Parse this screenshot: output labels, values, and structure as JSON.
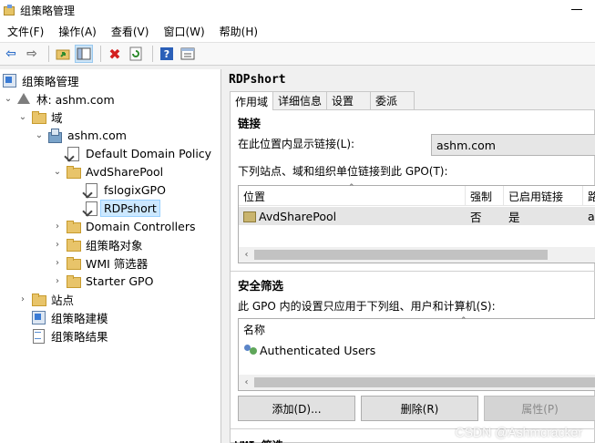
{
  "window": {
    "title": "组策略管理"
  },
  "menu": [
    "文件(F)",
    "操作(A)",
    "查看(V)",
    "窗口(W)",
    "帮助(H)"
  ],
  "toolbar": [
    "back-icon",
    "forward-icon",
    "up-folder-icon",
    "show-tree-icon",
    "delete-icon",
    "refresh-icon",
    "help-icon",
    "console-icon"
  ],
  "tree": {
    "root": "组策略管理",
    "forest": "林: ashm.com",
    "domains": "域",
    "domain": "ashm.com",
    "default_policy": "Default Domain Policy",
    "ou": "AvdSharePool",
    "gpo1": "fslogixGPO",
    "gpo2": "RDPshort",
    "dc": "Domain Controllers",
    "gpo_objects": "组策略对象",
    "wmi": "WMI 筛选器",
    "starter": "Starter GPO",
    "sites": "站点",
    "modeling": "组策略建模",
    "results": "组策略结果"
  },
  "detail": {
    "title": "RDPshort",
    "tabs": [
      "作用域",
      "详细信息",
      "设置",
      "委派"
    ],
    "links": {
      "heading": "链接",
      "location_label": "在此位置内显示链接(L):",
      "location_value": "ashm.com",
      "desc": "下列站点、域和组织单位链接到此 GPO(T):",
      "columns": [
        "位置",
        "强制",
        "已启用链接",
        "路"
      ],
      "rows": [
        {
          "location": "AvdSharePool",
          "enforced": "否",
          "enabled": "是",
          "path": "a"
        }
      ]
    },
    "security": {
      "heading": "安全筛选",
      "desc": "此 GPO 内的设置只应用于下列组、用户和计算机(S):",
      "column": "名称",
      "rows": [
        "Authenticated Users"
      ],
      "buttons": {
        "add": "添加(D)...",
        "remove": "删除(R)",
        "properties": "属性(P)"
      }
    },
    "wmi_heading_partial": "WMI 筛选"
  },
  "watermark": "CSDN @Ashmcracker"
}
